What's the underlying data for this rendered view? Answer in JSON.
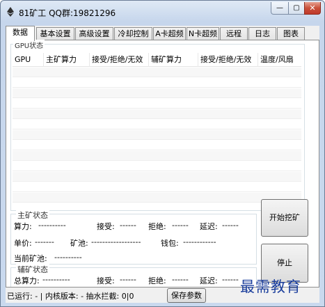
{
  "window": {
    "title": "81矿工 QQ群:19821296",
    "minimize_glyph": "—",
    "maximize_glyph": "▢",
    "close_glyph": "✕"
  },
  "tabs": [
    {
      "label": "数据"
    },
    {
      "label": "基本设置"
    },
    {
      "label": "高级设置"
    },
    {
      "label": "冷却控制"
    },
    {
      "label": "A卡超频"
    },
    {
      "label": "N卡超频"
    },
    {
      "label": "远程"
    },
    {
      "label": "日志"
    },
    {
      "label": "图表"
    }
  ],
  "gpu_status": {
    "group_label": "GPU状态",
    "columns": [
      "GPU",
      "主矿算力",
      "接受/拒绝/无效",
      "辅矿算力",
      "接受/拒绝/无效",
      "温度/风扇"
    ]
  },
  "main_status": {
    "group_label": "主矿状态",
    "hashrate_label": "算力:",
    "hashrate_value": "----------",
    "accepted_label": "接受:",
    "accepted_value": "------",
    "rejected_label": "拒绝:",
    "rejected_value": "------",
    "latency_label": "延迟:",
    "latency_value": "------",
    "price_label": "单价:",
    "price_value": "-------",
    "pool_label": "矿池:",
    "pool_value": "------------------",
    "wallet_label": "钱包:",
    "wallet_value": "------------",
    "current_pool_label": "当前矿池:",
    "current_pool_value": "----------"
  },
  "aux_status": {
    "group_label": "辅矿状态",
    "hashrate_label": "总算力:",
    "hashrate_value": "----------",
    "accepted_label": "接受:",
    "accepted_value": "------",
    "rejected_label": "拒绝:",
    "rejected_value": "------",
    "latency_label": "延迟:",
    "latency_value": "------"
  },
  "buttons": {
    "start": "开始挖矿",
    "stop": "停止",
    "save": "保存参数"
  },
  "statusbar": {
    "text": "已运行: - | 内核版本: - 抽水拦截: 0|0"
  },
  "watermark": "最需教育",
  "colors": {
    "titlebar": "#c6d6ec",
    "close_button": "#c0392b",
    "watermark": "#1c3f9d"
  }
}
